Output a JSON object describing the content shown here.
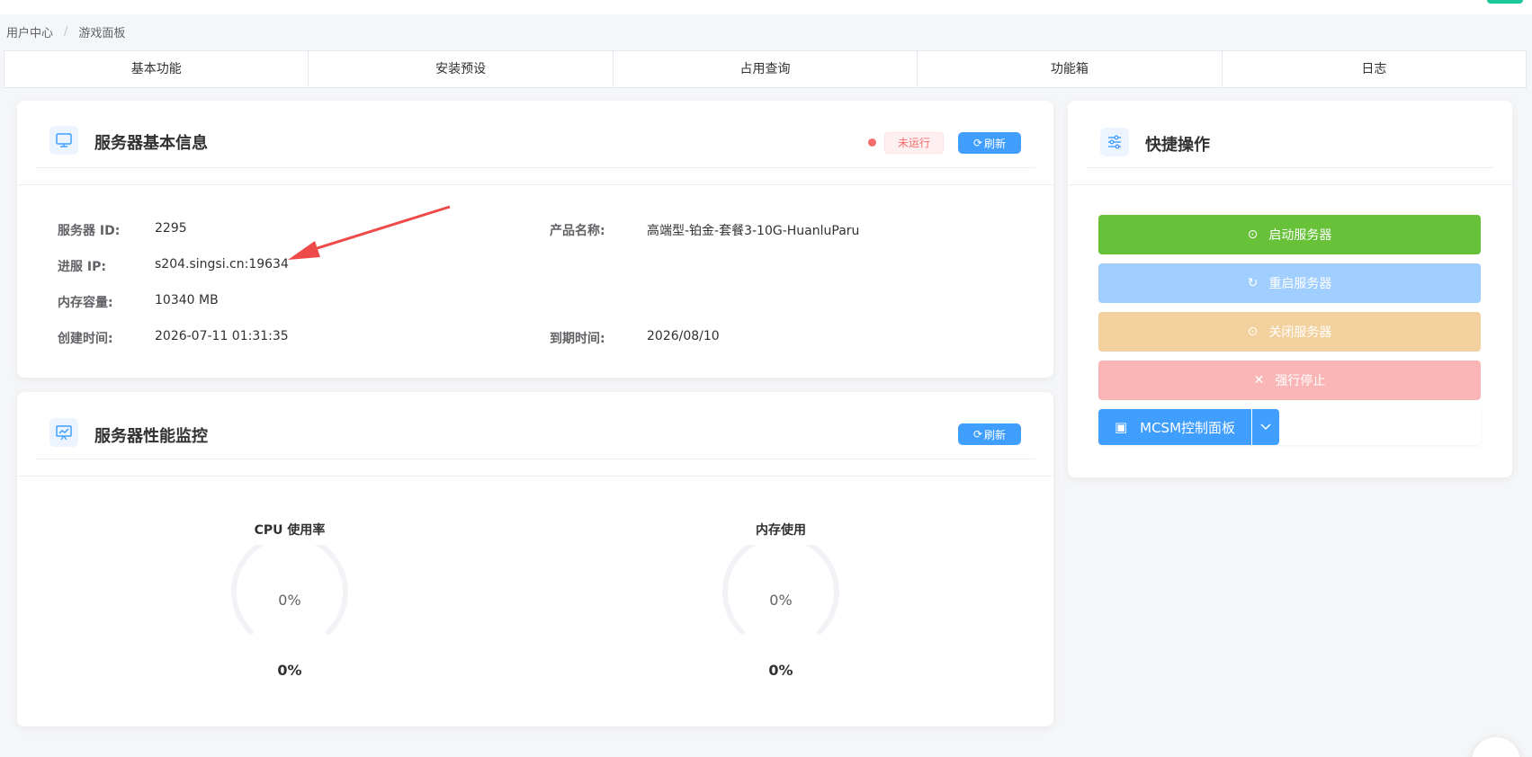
{
  "breadcrumb": {
    "home": "用户中心",
    "separator": "/",
    "current": "游戏面板"
  },
  "tabs": [
    "基本功能",
    "安装预设",
    "占用查询",
    "功能箱",
    "日志"
  ],
  "server_info": {
    "title": "服务器基本信息",
    "status": "未运行",
    "refresh_label": "刷新",
    "fields": {
      "server_id": {
        "label": "服务器 ID:",
        "value": "2295"
      },
      "ip": {
        "label": "进服 IP:",
        "value": "s204.singsi.cn:19634"
      },
      "memory": {
        "label": "内存容量:",
        "value": "10340 MB"
      },
      "created": {
        "label": "创建时间:",
        "value": "2026-07-11 01:31:35"
      },
      "product": {
        "label": "产品名称:",
        "value": "高端型-铂金-套餐3-10G-HuanluParu"
      },
      "expires": {
        "label": "到期时间:",
        "value": "2026/08/10"
      }
    }
  },
  "monitor": {
    "title": "服务器性能监控",
    "refresh_label": "刷新",
    "cpu": {
      "label": "CPU 使用率",
      "inner": "0%",
      "value": "0%",
      "fraction": 0
    },
    "memory": {
      "label": "内存使用",
      "inner": "0%",
      "value": "0%",
      "fraction": 0
    }
  },
  "quick_actions": {
    "title": "快捷操作",
    "start": "启动服务器",
    "restart": "重启服务器",
    "stop": "关闭服务器",
    "kill": "强行停止",
    "mcsm": "MCSM控制面板"
  },
  "colors": {
    "primary": "#409eff",
    "success": "#67c23a",
    "restart_disabled": "#a0cfff",
    "stop_disabled": "#f3d19e",
    "kill_disabled": "#fab6b6",
    "danger": "#f56c6c"
  }
}
